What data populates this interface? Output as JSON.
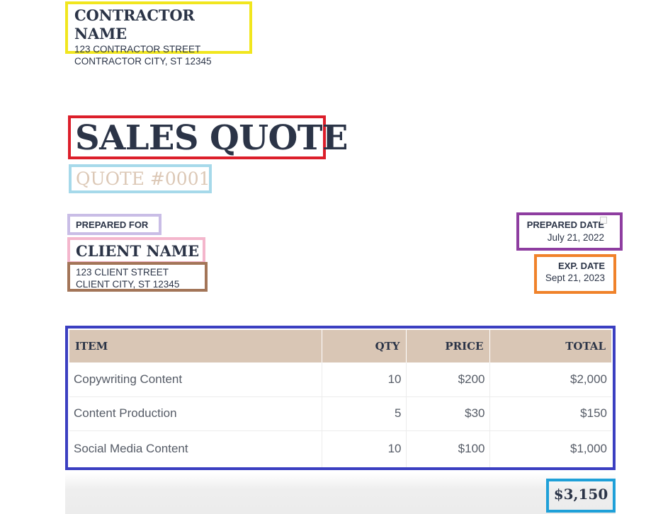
{
  "contractor": {
    "name": "CONTRACTOR NAME",
    "street": "123 CONTRACTOR STREET",
    "city": "CONTRACTOR CITY, ST 12345"
  },
  "document": {
    "title": "SALES QUOTE",
    "quote_number": "QUOTE #0001"
  },
  "client": {
    "section_label": "PREPARED FOR",
    "name": "CLIENT NAME",
    "street": "123 CLIENT STREET",
    "city": "CLIENT CITY, ST 12345"
  },
  "dates": {
    "prepared_label": "PREPARED DATE",
    "prepared_value": "July 21, 2022",
    "exp_label": "EXP. DATE",
    "exp_value": "Sept 21, 2023"
  },
  "table": {
    "headers": [
      "ITEM",
      "QTY",
      "PRICE",
      "TOTAL"
    ],
    "rows": [
      [
        "Copywriting Content",
        "10",
        "$200",
        "$2,000"
      ],
      [
        "Content Production",
        "5",
        "$30",
        "$150"
      ],
      [
        "Social Media Content",
        "10",
        "$100",
        "$1,000"
      ]
    ]
  },
  "summary": {
    "grand_total": "$3,150"
  },
  "colors": {
    "navy_text": "#2b3447",
    "header_tan": "#d9c6b5",
    "quote_number_tan": "#dcc8b6",
    "box_yellow": "#f1e61e",
    "box_red": "#dc1e2a",
    "box_light_blue": "#a6d9ea",
    "box_lavender": "#c9bde6",
    "box_pink": "#f4b6cc",
    "box_brown": "#a37558",
    "box_purple": "#8e3da0",
    "box_orange": "#f0822a",
    "box_indigo": "#3b3fc1",
    "box_cyan": "#1fa0d8"
  }
}
